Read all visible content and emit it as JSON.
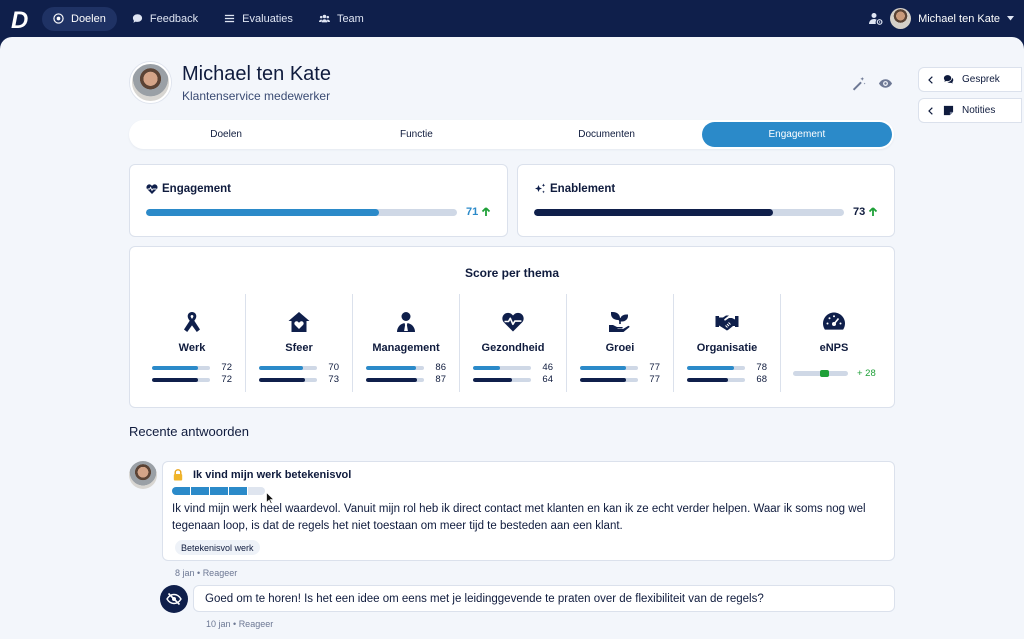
{
  "nav": {
    "logo": "D",
    "items": [
      {
        "label": "Doelen",
        "icon": "target-icon",
        "active": true
      },
      {
        "label": "Feedback",
        "icon": "chat-bubble-icon",
        "active": false
      },
      {
        "label": "Evaluaties",
        "icon": "list-icon",
        "active": false
      },
      {
        "label": "Team",
        "icon": "team-icon",
        "active": false
      }
    ],
    "user_name": "Michael ten Kate"
  },
  "profile": {
    "name": "Michael ten Kate",
    "role": "Klantenservice medewerker"
  },
  "side_buttons": [
    {
      "label": "Gesprek",
      "icon": "chat-icon"
    },
    {
      "label": "Notities",
      "icon": "note-icon"
    }
  ],
  "tabs": [
    {
      "label": "Doelen",
      "active": false
    },
    {
      "label": "Functie",
      "active": false
    },
    {
      "label": "Documenten",
      "active": false
    },
    {
      "label": "Engagement",
      "active": true
    }
  ],
  "engagement": {
    "title": "Engagement",
    "value": "71",
    "fraction": 0.75,
    "color": "#2b8ac9",
    "trend": "up"
  },
  "enablement": {
    "title": "Enablement",
    "value": "73",
    "fraction": 0.77,
    "color": "#0f1f4b",
    "trend": "up"
  },
  "themes": {
    "title": "Score per thema",
    "items": [
      {
        "name": "Werk",
        "icon": "ribbon-icon",
        "score1": "72",
        "score2": "72",
        "f1": 0.8,
        "f2": 0.8
      },
      {
        "name": "Sfeer",
        "icon": "home-heart-icon",
        "score1": "70",
        "score2": "73",
        "f1": 0.75,
        "f2": 0.8
      },
      {
        "name": "Management",
        "icon": "manager-icon",
        "score1": "86",
        "score2": "87",
        "f1": 0.87,
        "f2": 0.88
      },
      {
        "name": "Gezondheid",
        "icon": "heartbeat-icon",
        "score1": "46",
        "score2": "64",
        "f1": 0.47,
        "f2": 0.68
      },
      {
        "name": "Groei",
        "icon": "seedling-icon",
        "score1": "77",
        "score2": "77",
        "f1": 0.8,
        "f2": 0.8
      },
      {
        "name": "Organisatie",
        "icon": "handshake-icon",
        "score1": "78",
        "score2": "68",
        "f1": 0.81,
        "f2": 0.7
      }
    ],
    "enps": {
      "name": "eNPS",
      "icon": "gauge-icon",
      "value": "+ 28"
    }
  },
  "recent": {
    "title": "Recente antwoorden",
    "answer": {
      "question": "Ik vind mijn werk betekenisvol",
      "score_segments": 4,
      "total_segments": 5,
      "text": "Ik vind mijn werk heel waardevol. Vanuit mijn rol heb ik direct contact met klanten en kan ik ze echt verder helpen. Waar ik soms nog wel tegenaan loop, is dat de regels het niet toestaan om meer tijd te besteden aan een klant.",
      "tag": "Betekenisvol werk",
      "date": "8 jan",
      "action": "Reageer"
    },
    "reply": {
      "text": "Goed om te horen! Is het een idee om eens met je leidinggevende te praten over de flexibiliteit van de regels?",
      "date": "10 jan",
      "action": "Reageer"
    }
  },
  "colors": {
    "navy": "#0f1f4b",
    "blue": "#2b8ac9",
    "green": "#1fa038",
    "track": "#cfd8e6"
  }
}
